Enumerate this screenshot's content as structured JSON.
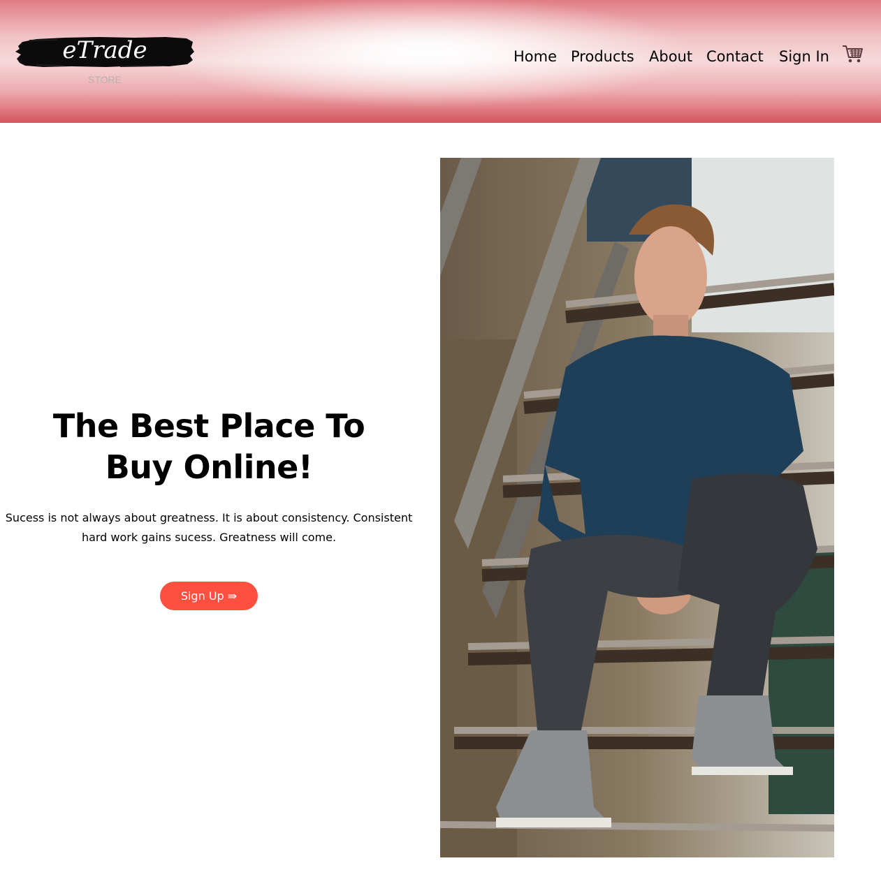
{
  "header": {
    "logo": {
      "name": "eTrade",
      "subtitle": "STORE"
    },
    "nav": [
      {
        "label": "Home"
      },
      {
        "label": "Products"
      },
      {
        "label": "About"
      },
      {
        "label": "Contact"
      },
      {
        "label": "Sign In"
      }
    ],
    "cart_icon": "shopping-cart-icon"
  },
  "hero": {
    "title_line1": "The Best Place To",
    "title_line2": "Buy Online!",
    "text_line1": "Sucess is not always about greatness. It is about consistency. Consistent",
    "text_line2": "hard work gains sucess. Greatness will come.",
    "button_label": "Sign Up ⇛",
    "image_subject": "young man in navy sweater and jeans sitting on outdoor metal stairs"
  },
  "colors": {
    "header_top": "#e07d83",
    "header_bottom": "#d4555d",
    "button": "#ff4f3f",
    "button_text": "#ffffff"
  }
}
